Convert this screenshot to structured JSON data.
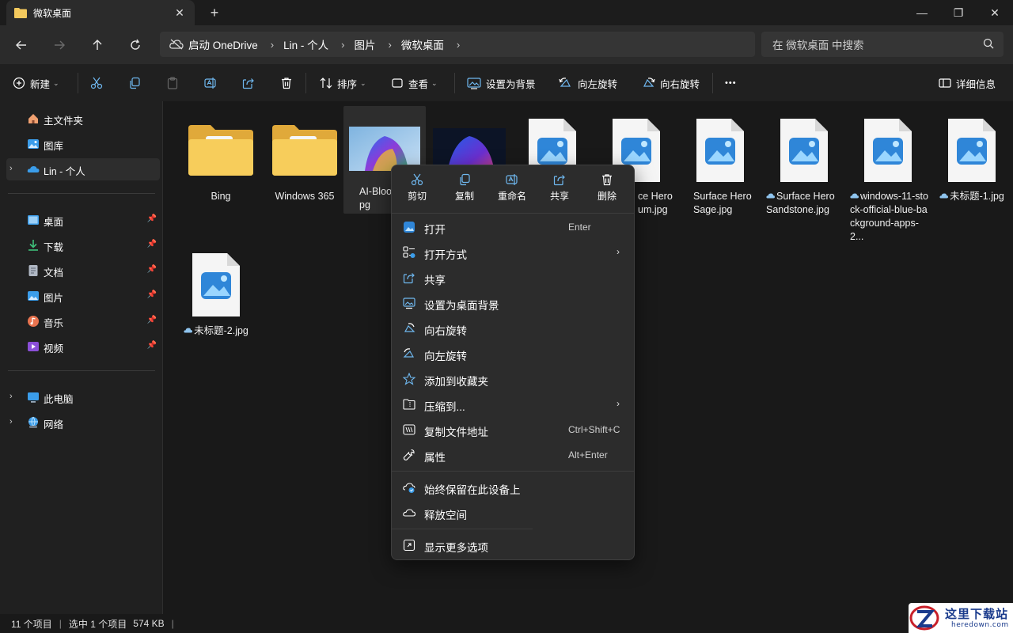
{
  "window": {
    "tab_title": "微软桌面",
    "new_tab": "+",
    "minimize": "—",
    "maximize": "❐",
    "close": "✕"
  },
  "address": {
    "breadcrumbs": [
      "启动 OneDrive",
      "Lin - 个人",
      "图片",
      "微软桌面"
    ],
    "search_placeholder": "在 微软桌面 中搜索"
  },
  "commands": {
    "new": "新建",
    "sort": "排序",
    "view": "查看",
    "set_background": "设置为背景",
    "rotate_left": "向左旋转",
    "rotate_right": "向右旋转",
    "more": "•••",
    "details": "详细信息"
  },
  "sidebar": {
    "home": "主文件夹",
    "gallery": "图库",
    "onedrive": "Lin - 个人",
    "desktop": "桌面",
    "downloads": "下载",
    "documents": "文档",
    "pictures": "图片",
    "music": "音乐",
    "videos": "视频",
    "this_pc": "此电脑",
    "network": "网络"
  },
  "files": [
    {
      "name": "Bing",
      "kind": "folder"
    },
    {
      "name": "Windows 365",
      "kind": "folder"
    },
    {
      "name": "AI-Bloom.jpg",
      "visible_caption": "AI-Bloo\npg",
      "kind": "photo-bloom",
      "selected": true
    },
    {
      "name": "(bloom photo)",
      "kind": "photo-bloom-dark"
    },
    {
      "name": "Surface Hero Album.jpg",
      "visible_caption": "ce Hero\num.jpg",
      "kind": "image"
    },
    {
      "name": "Surface Hero Album.jpg",
      "visible_caption": "ce Hero\num.jpg",
      "kind": "image"
    },
    {
      "name": "Surface Hero Sage.jpg",
      "visible_caption": "Surface Hero Sage.jpg",
      "kind": "image"
    },
    {
      "name": "Surface Hero Sandstone.jpg",
      "visible_caption": "Surface Hero Sandstone.jpg",
      "kind": "image",
      "cloud": true
    },
    {
      "name": "windows-11-stock-official-blue-background-apps-2...",
      "visible_caption": "windows-11-stock-official-blue-background-apps-2...",
      "kind": "image",
      "cloud": true
    },
    {
      "name": "未标题-1.jpg",
      "visible_caption": "未标题-1.jpg",
      "kind": "image",
      "cloud": true
    },
    {
      "name": "未标题-2.jpg",
      "visible_caption": "未标题-2.jpg",
      "kind": "image",
      "cloud": true
    }
  ],
  "captions": {
    "bing": "Bing",
    "w365": "Windows 365",
    "ai_line1": "AI-Bloo",
    "ai_line2": "pg",
    "album_line1": "ce Hero",
    "album_line2": "um.jpg",
    "sage": "Surface Hero Sage.jpg",
    "sandstone": "Surface Hero Sandstone.jpg",
    "win11": "windows-11-stock-official-blue-background-apps-2...",
    "untitled1": "未标题-1.jpg",
    "untitled2": "未标题-2.jpg"
  },
  "context_menu": {
    "quick": {
      "cut": "剪切",
      "copy": "复制",
      "rename": "重命名",
      "share": "共享",
      "delete": "删除"
    },
    "items": {
      "open": "打开",
      "open_shortcut": "Enter",
      "open_with": "打开方式",
      "share": "共享",
      "set_desktop_bg": "设置为桌面背景",
      "rotate_right": "向右旋转",
      "rotate_left": "向左旋转",
      "add_favorites": "添加到收藏夹",
      "compress": "压缩到...",
      "copy_path": "复制文件地址",
      "copy_path_shortcut": "Ctrl+Shift+C",
      "properties": "属性",
      "properties_shortcut": "Alt+Enter",
      "keep_on_device": "始终保留在此设备上",
      "free_space": "释放空间",
      "more_options": "显示更多选项"
    }
  },
  "status": {
    "count": "11 个项目",
    "selected": "选中 1 个项目",
    "size": "574 KB",
    "sep": "|"
  },
  "watermark": {
    "text": "这里下载站",
    "sub": "heredown.com"
  },
  "colors": {
    "folder_yellow": "#f4c95d",
    "accent_blue": "#3b9dea",
    "bg": "#191919",
    "menu_bg": "#2c2c2c"
  }
}
